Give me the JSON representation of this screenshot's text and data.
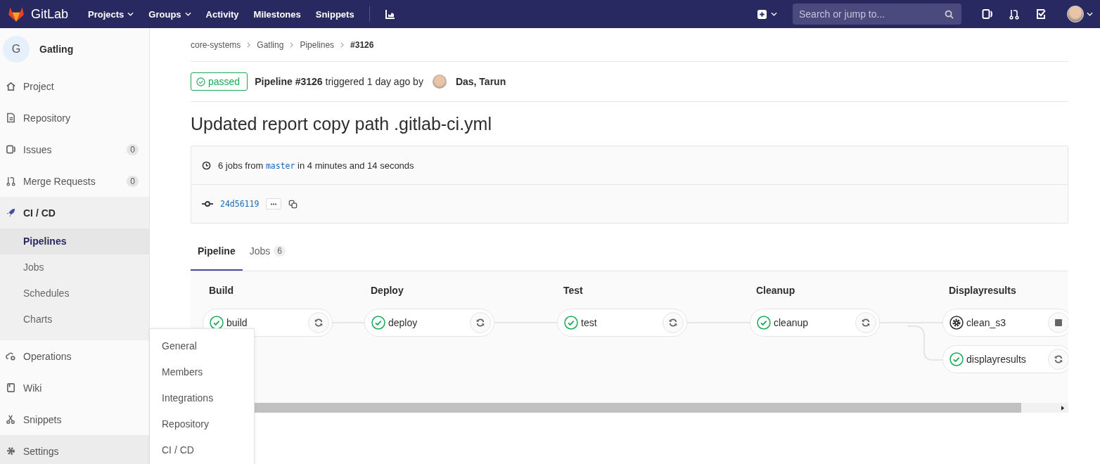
{
  "navbar": {
    "brand": "GitLab",
    "links": [
      {
        "label": "Projects",
        "dropdown": true
      },
      {
        "label": "Groups",
        "dropdown": true
      },
      {
        "label": "Activity",
        "dropdown": false
      },
      {
        "label": "Milestones",
        "dropdown": false
      },
      {
        "label": "Snippets",
        "dropdown": false
      }
    ],
    "search": {
      "placeholder": "Search or jump to..."
    }
  },
  "sidebar": {
    "project": {
      "initial": "G",
      "name": "Gatling"
    },
    "items": [
      {
        "label": "Project",
        "selected": false
      },
      {
        "label": "Repository",
        "selected": false
      },
      {
        "label": "Issues",
        "badge": "0",
        "selected": false
      },
      {
        "label": "Merge Requests",
        "badge": "0",
        "selected": false
      },
      {
        "label": "CI / CD",
        "selected": true,
        "children": [
          {
            "label": "Pipelines",
            "selected": true
          },
          {
            "label": "Jobs",
            "selected": false
          },
          {
            "label": "Schedules",
            "selected": false
          },
          {
            "label": "Charts",
            "selected": false
          }
        ]
      },
      {
        "label": "Operations",
        "selected": false
      },
      {
        "label": "Wiki",
        "selected": false
      },
      {
        "label": "Snippets",
        "selected": false
      },
      {
        "label": "Settings",
        "selected": false,
        "hovered": true
      }
    ],
    "flyout": [
      "General",
      "Members",
      "Integrations",
      "Repository",
      "CI / CD"
    ]
  },
  "breadcrumbs": [
    "core-systems",
    "Gatling",
    "Pipelines",
    "#3126"
  ],
  "pipeline": {
    "status": "passed",
    "sentence": "**Pipeline #3126** triggered 1 day ago by",
    "user": "Das, Tarun",
    "title": "Updated report copy path .gitlab-ci.yml",
    "summary_prefix": "6 jobs from",
    "branch": "master",
    "summary_suffix": "in 4 minutes and 14 seconds",
    "commit": "24d56119"
  },
  "tabs": [
    {
      "label": "Pipeline",
      "selected": true
    },
    {
      "label": "Jobs",
      "count": "6",
      "selected": false
    }
  ],
  "stages": [
    {
      "name": "Build",
      "jobs": [
        {
          "name": "build",
          "kind": "passed"
        }
      ]
    },
    {
      "name": "Deploy",
      "jobs": [
        {
          "name": "deploy",
          "kind": "passed"
        }
      ]
    },
    {
      "name": "Test",
      "jobs": [
        {
          "name": "test",
          "kind": "passed"
        }
      ]
    },
    {
      "name": "Cleanup",
      "jobs": [
        {
          "name": "cleanup",
          "kind": "passed"
        }
      ]
    },
    {
      "name": "Displayresults",
      "jobs": [
        {
          "name": "clean_s3",
          "kind": "running"
        },
        {
          "name": "displayresults",
          "kind": "passed"
        }
      ]
    }
  ]
}
